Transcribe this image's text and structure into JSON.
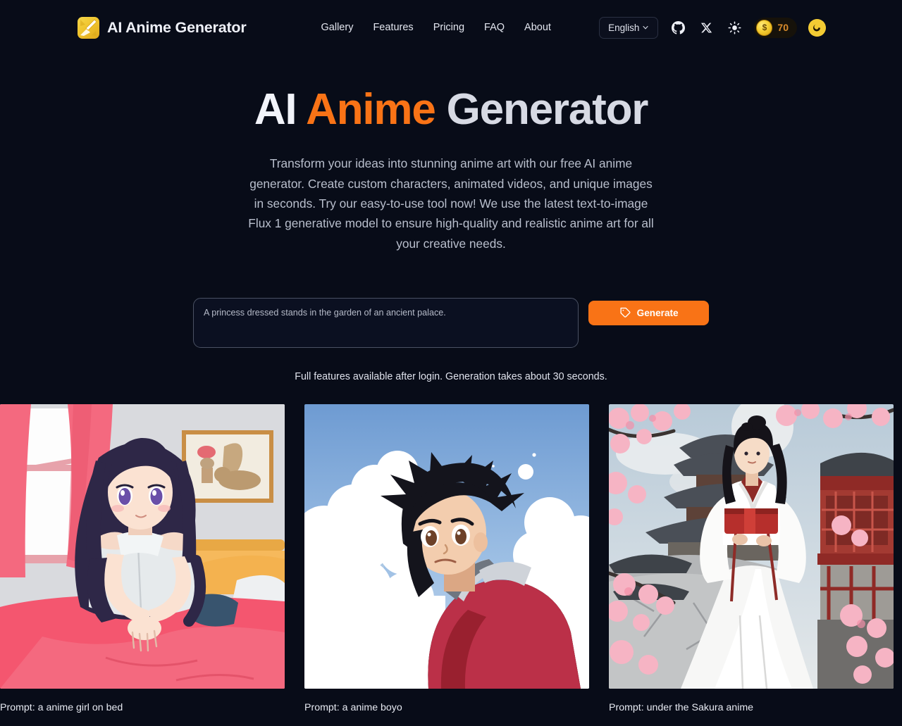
{
  "brand": {
    "name": "AI Anime Generator",
    "logo_icon": "brush-logo-icon",
    "logo_color": "#efc32c"
  },
  "nav": {
    "items": [
      {
        "label": "Gallery"
      },
      {
        "label": "Features"
      },
      {
        "label": "Pricing"
      },
      {
        "label": "FAQ"
      },
      {
        "label": "About"
      }
    ]
  },
  "header_right": {
    "language": {
      "label": "English",
      "chevron": "⌄"
    },
    "github_icon": "github-icon",
    "twitter_icon": "x-twitter-icon",
    "theme_icon": "sun-icon",
    "credits": {
      "symbol": "$",
      "count": "70"
    },
    "avatar_icon": "user-avatar-icon"
  },
  "hero": {
    "title_part1": "AI ",
    "title_part2": "Anime",
    "title_part3": " Generator",
    "accent_color": "#f97316",
    "subtitle": "Transform your ideas into stunning anime art with our free AI anime generator. Create custom characters, animated videos, and unique images in seconds. Try our easy-to-use tool now! We use the latest text-to-image Flux 1 generative model to ensure high-quality and realistic anime art for all your creative needs."
  },
  "prompt": {
    "placeholder": "A princess dressed stands in the garden of an ancient palace.",
    "value": "",
    "generate_label": "Generate",
    "generate_icon": "tag-icon",
    "hint": "Full features available after login. Generation takes about 30 seconds."
  },
  "gallery": {
    "items": [
      {
        "caption": "Prompt: a anime girl on bed",
        "alt": "anime girl sitting on a pink bed in a bedroom"
      },
      {
        "caption": "Prompt: a anime boyo",
        "alt": "anime boy with spiky black hair in a red jacket against a cloudy blue sky"
      },
      {
        "caption": "Prompt: under the Sakura anime",
        "alt": "woman in white hanfu with red sash under cherry blossoms by a pagoda"
      }
    ]
  },
  "theme": {
    "background": "#080c18",
    "text": "#e8eaf2"
  }
}
